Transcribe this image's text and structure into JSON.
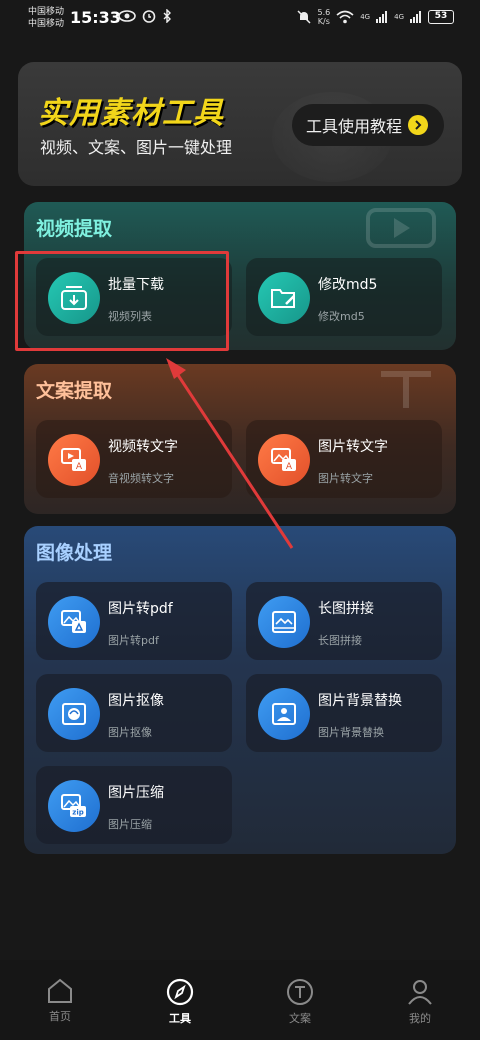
{
  "status_bar": {
    "carrier1": "中国移动",
    "carrier2": "中国移动",
    "time": "15:33",
    "net_speed_value": "5.6",
    "net_speed_unit": "K/s",
    "signal1": "4G",
    "signal2": "4G",
    "battery": "53"
  },
  "banner": {
    "title": "实用素材工具",
    "subtitle": "视频、文案、图片一键处理",
    "tutorial_label": "工具使用教程"
  },
  "sections": {
    "video": {
      "title": "视频提取",
      "cards": [
        {
          "title": "批量下载",
          "subtitle": "视频列表"
        },
        {
          "title": "修改md5",
          "subtitle": "修改md5"
        }
      ]
    },
    "text": {
      "title": "文案提取",
      "cards": [
        {
          "title": "视频转文字",
          "subtitle": "音视频转文字"
        },
        {
          "title": "图片转文字",
          "subtitle": "图片转文字"
        }
      ]
    },
    "image": {
      "title": "图像处理",
      "cards": [
        {
          "title": "图片转pdf",
          "subtitle": "图片转pdf"
        },
        {
          "title": "长图拼接",
          "subtitle": "长图拼接"
        },
        {
          "title": "图片抠像",
          "subtitle": "图片抠像"
        },
        {
          "title": "图片背景替换",
          "subtitle": "图片背景替换"
        },
        {
          "title": "图片压缩",
          "subtitle": "图片压缩"
        }
      ]
    }
  },
  "nav": {
    "items": [
      {
        "label": "首页",
        "icon": "home-icon"
      },
      {
        "label": "工具",
        "icon": "compass-icon",
        "active": true
      },
      {
        "label": "文案",
        "icon": "text-t-icon"
      },
      {
        "label": "我的",
        "icon": "user-icon"
      }
    ]
  },
  "colors": {
    "accent_yellow": "#f2d61a",
    "teal": "#25c9b4",
    "orange": "#ff7a46",
    "blue": "#3f9cf2",
    "highlight_red": "#e03a3a"
  }
}
